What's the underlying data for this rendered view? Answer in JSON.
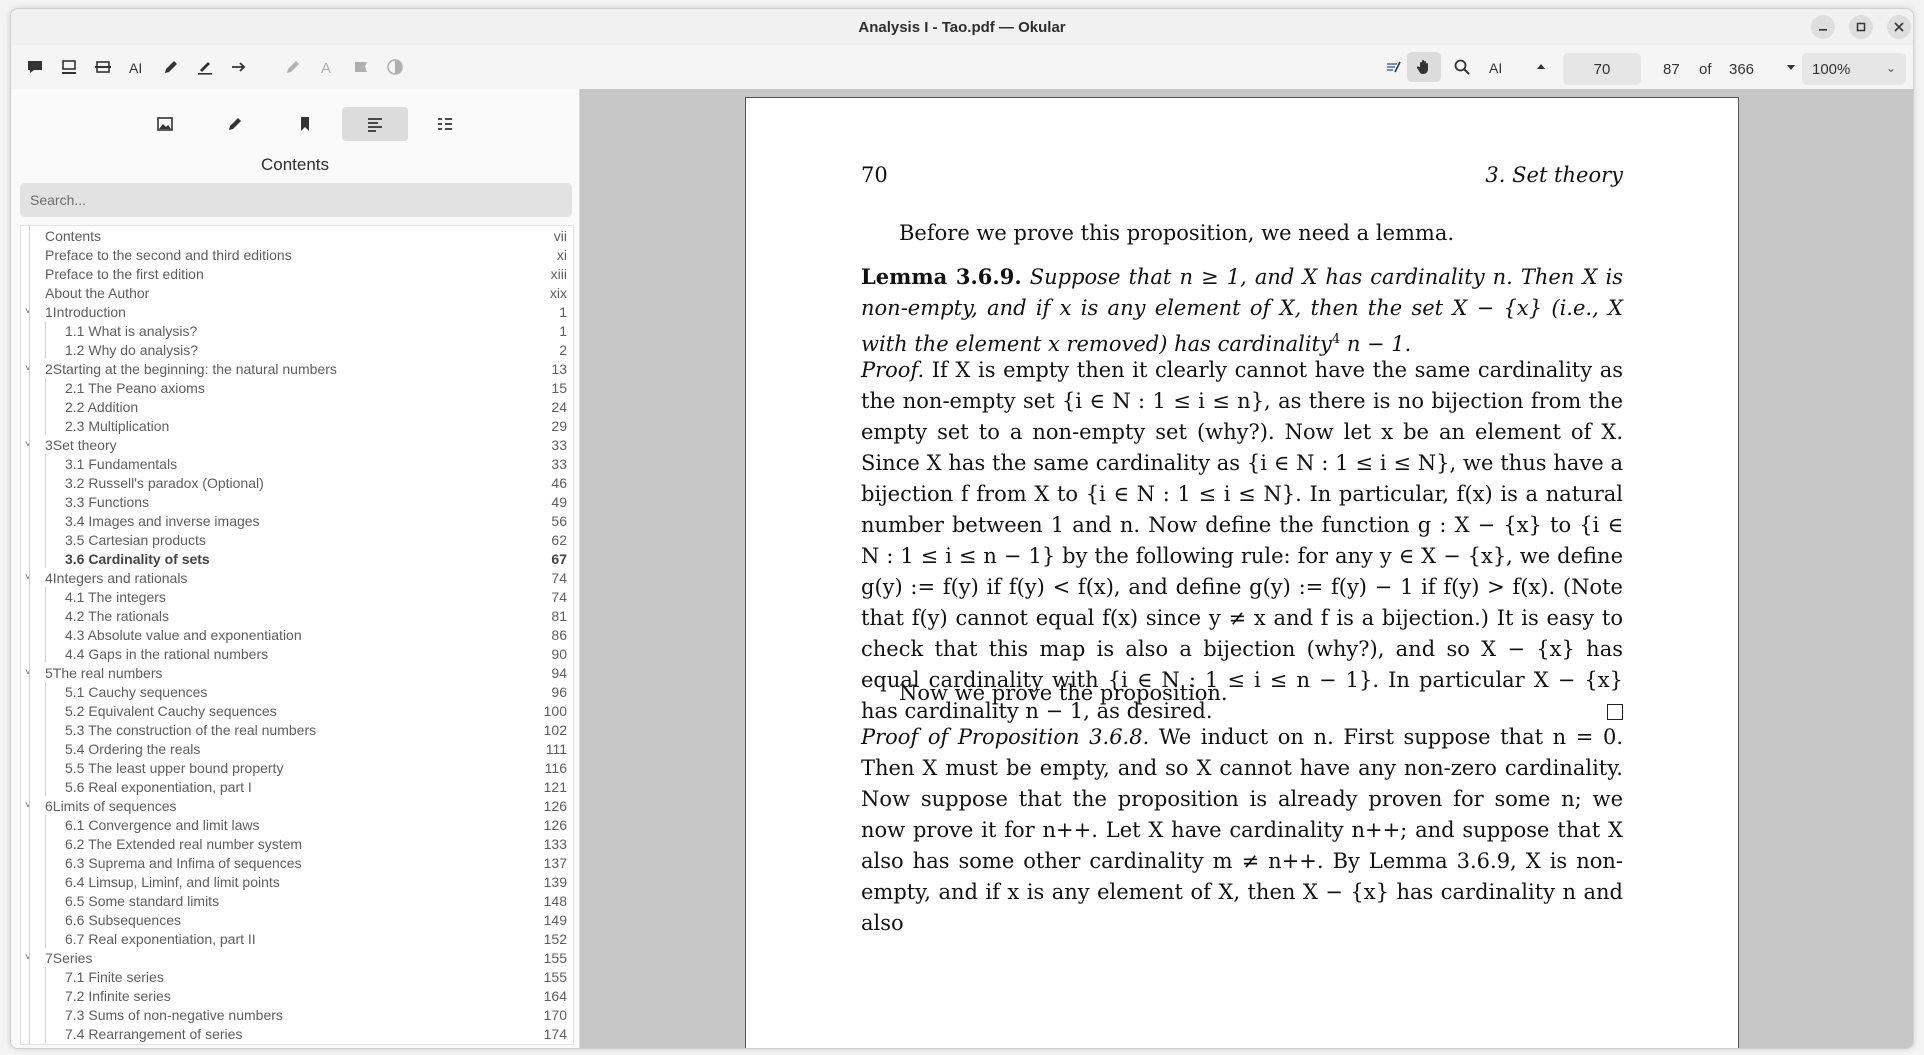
{
  "window": {
    "title": "Analysis I - Tao.pdf — Okular"
  },
  "toolbar": {
    "left_icons": [
      "comment-icon",
      "underline-icon",
      "strikeout-icon",
      "typewriter-icon",
      "pencil-icon",
      "highlighter-icon",
      "arrow-icon",
      "pen-icon",
      "text-color-icon",
      "stamp-icon",
      "opacity-icon"
    ],
    "current_page": "70",
    "page_index": "87",
    "of_label": "of",
    "total_pages": "366",
    "zoom": "100%"
  },
  "sidebar": {
    "title": "Contents",
    "search_placeholder": "Search...",
    "tabs": [
      "thumbnails",
      "annotations",
      "bookmarks",
      "contents",
      "layers"
    ],
    "toc": [
      {
        "level": 0,
        "label": "Contents",
        "page": "vii"
      },
      {
        "level": 0,
        "label": "Preface to the second and third editions",
        "page": "xi"
      },
      {
        "level": 0,
        "label": "Preface to the first edition",
        "page": "xiii"
      },
      {
        "level": 0,
        "label": "About the Author",
        "page": "xix"
      },
      {
        "level": 0,
        "label": "1Introduction",
        "page": "1",
        "expanded": true
      },
      {
        "level": 1,
        "label": "1.1 What is analysis?",
        "page": "1"
      },
      {
        "level": 1,
        "label": "1.2 Why do analysis?",
        "page": "2"
      },
      {
        "level": 0,
        "label": "2Starting at the beginning: the natural numbers",
        "page": "13",
        "expanded": true
      },
      {
        "level": 1,
        "label": "2.1 The Peano axioms",
        "page": "15"
      },
      {
        "level": 1,
        "label": "2.2 Addition",
        "page": "24"
      },
      {
        "level": 1,
        "label": "2.3 Multiplication",
        "page": "29"
      },
      {
        "level": 0,
        "label": "3Set theory",
        "page": "33",
        "expanded": true
      },
      {
        "level": 1,
        "label": "3.1 Fundamentals",
        "page": "33"
      },
      {
        "level": 1,
        "label": "3.2 Russell's paradox (Optional)",
        "page": "46"
      },
      {
        "level": 1,
        "label": "3.3 Functions",
        "page": "49"
      },
      {
        "level": 1,
        "label": "3.4 Images and inverse images",
        "page": "56"
      },
      {
        "level": 1,
        "label": "3.5 Cartesian products",
        "page": "62"
      },
      {
        "level": 1,
        "label": "3.6 Cardinality of sets",
        "page": "67",
        "current": true
      },
      {
        "level": 0,
        "label": "4Integers and rationals",
        "page": "74",
        "expanded": true
      },
      {
        "level": 1,
        "label": "4.1 The integers",
        "page": "74"
      },
      {
        "level": 1,
        "label": "4.2 The rationals",
        "page": "81"
      },
      {
        "level": 1,
        "label": "4.3 Absolute value and exponentiation",
        "page": "86"
      },
      {
        "level": 1,
        "label": "4.4 Gaps in the rational numbers",
        "page": "90"
      },
      {
        "level": 0,
        "label": "5The real numbers",
        "page": "94",
        "expanded": true
      },
      {
        "level": 1,
        "label": "5.1 Cauchy sequences",
        "page": "96"
      },
      {
        "level": 1,
        "label": "5.2 Equivalent Cauchy sequences",
        "page": "100"
      },
      {
        "level": 1,
        "label": "5.3 The construction of the real numbers",
        "page": "102"
      },
      {
        "level": 1,
        "label": "5.4 Ordering the reals",
        "page": "111"
      },
      {
        "level": 1,
        "label": "5.5 The least upper bound property",
        "page": "116"
      },
      {
        "level": 1,
        "label": "5.6 Real exponentiation, part I",
        "page": "121"
      },
      {
        "level": 0,
        "label": "6Limits of sequences",
        "page": "126",
        "expanded": true
      },
      {
        "level": 1,
        "label": "6.1 Convergence and limit laws",
        "page": "126"
      },
      {
        "level": 1,
        "label": "6.2 The Extended real number system",
        "page": "133"
      },
      {
        "level": 1,
        "label": "6.3 Suprema and Infima of sequences",
        "page": "137"
      },
      {
        "level": 1,
        "label": "6.4 Limsup, Liminf, and limit points",
        "page": "139"
      },
      {
        "level": 1,
        "label": "6.5 Some standard limits",
        "page": "148"
      },
      {
        "level": 1,
        "label": "6.6 Subsequences",
        "page": "149"
      },
      {
        "level": 1,
        "label": "6.7 Real exponentiation, part II",
        "page": "152"
      },
      {
        "level": 0,
        "label": "7Series",
        "page": "155",
        "expanded": true
      },
      {
        "level": 1,
        "label": "7.1 Finite series",
        "page": "155"
      },
      {
        "level": 1,
        "label": "7.2 Infinite series",
        "page": "164"
      },
      {
        "level": 1,
        "label": "7.3 Sums of non-negative numbers",
        "page": "170"
      },
      {
        "level": 1,
        "label": "7.4 Rearrangement of series",
        "page": "174"
      }
    ]
  },
  "document": {
    "page_number": "70",
    "running_head": "3.  Set theory",
    "para1": "Before we prove this proposition, we need a lemma.",
    "lemma_label": "Lemma 3.6.9.",
    "lemma_text": "Suppose that n ≥ 1, and X has cardinality n. Then X is non-empty, and if x is any element of X, then the set X − {x} (i.e., X with the element x removed) has cardinality",
    "lemma_footnote": "4",
    "lemma_end": " n − 1.",
    "proof_label": "Proof.",
    "proof_text": "If X is empty then it clearly cannot have the same cardinality as the non-empty set {i ∈ N : 1 ≤ i ≤ n}, as there is no bijection from the empty set to a non-empty set (why?). Now let x be an element of X. Since X has the same cardinality as {i ∈ N : 1 ≤ i ≤ N}, we thus have a bijection f from X to {i ∈ N : 1 ≤ i ≤ N}. In particular, f(x) is a natural number between 1 and n. Now define the function g : X − {x} to {i ∈ N : 1 ≤ i ≤ n − 1} by the following rule: for any y ∈ X − {x}, we define g(y) := f(y) if f(y) < f(x), and define g(y) := f(y) − 1 if f(y) > f(x). (Note that f(y) cannot equal f(x) since y ≠ x and f is a bijection.) It is easy to check that this map is also a bijection (why?), and so X − {x} has equal cardinality with {i ∈ N : 1 ≤ i ≤ n − 1}. In particular X − {x} has cardinality n − 1, as desired.",
    "para2": "Now we prove the proposition.",
    "proof2_label": "Proof of Proposition 3.6.8.",
    "proof2_text": "We induct on n. First suppose that n = 0. Then X must be empty, and so X cannot have any non-zero cardinality. Now suppose that the proposition is already proven for some n; we now prove it for n++. Let X have cardinality n++; and suppose that X also has some other cardinality m ≠ n++. By Lemma 3.6.9, X is non-empty, and if x is any element of X, then X − {x} has cardinality n and also"
  }
}
